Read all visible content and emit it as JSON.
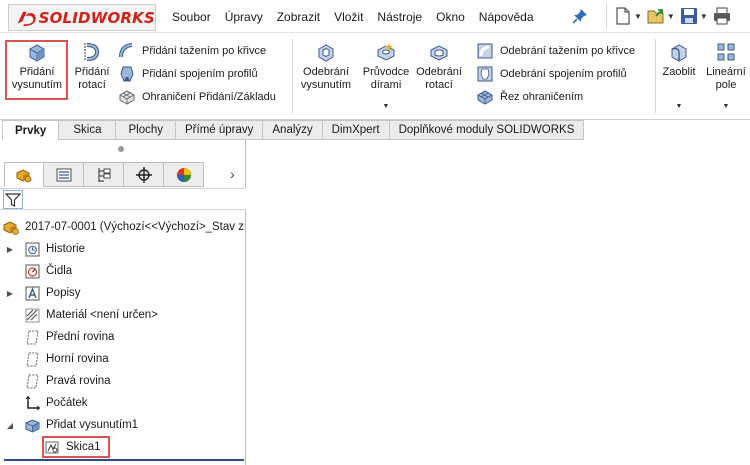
{
  "app": {
    "logo_text": "SOLIDWORKS",
    "brand_color": "#d0221b"
  },
  "menu": {
    "items": [
      "Soubor",
      "Úpravy",
      "Zobrazit",
      "Vložit",
      "Nástroje",
      "Okno",
      "Nápověda"
    ]
  },
  "quick_access": {
    "icons": [
      "new-document-icon",
      "open-file-icon",
      "save-icon",
      "print-icon"
    ]
  },
  "command_manager": {
    "extruded_boss": "Přidání\nvysunutím",
    "revolved_boss": "Přidání\nrotací",
    "swept_boss": "Přidání tažením po křivce",
    "lofted_boss": "Přidání spojením profilů",
    "boundary_boss": "Ohraničení Přidání/Základu",
    "extruded_cut": "Odebrání\nvysunutím",
    "hole_wizard": "Průvodce\ndírami",
    "revolved_cut": "Odebrání\nrotací",
    "swept_cut": "Odebrání tažením po křivce",
    "lofted_cut": "Odebrání spojením profilů",
    "boundary_cut": "Řez ohraničením",
    "fillet": "Zaoblit",
    "linear_pattern": "Lineární\npole"
  },
  "tabs": [
    {
      "label": "Prvky",
      "active": true
    },
    {
      "label": "Skica",
      "active": false
    },
    {
      "label": "Plochy",
      "active": false
    },
    {
      "label": "Přímé úpravy",
      "active": false
    },
    {
      "label": "Analýzy",
      "active": false
    },
    {
      "label": "DimXpert",
      "active": false
    },
    {
      "label": "Doplňkové moduly SOLIDWORKS",
      "active": false
    }
  ],
  "feature_tree": {
    "root": "2017-07-0001  (Výchozí<<Výchozí>_Stav z",
    "history": "Historie",
    "sensors": "Čidla",
    "annotations": "Popisy",
    "material": "Materiál <není určen>",
    "front_plane": "Přední rovina",
    "top_plane": "Horní rovina",
    "right_plane": "Pravá rovina",
    "origin": "Počátek",
    "extrude": "Přidat vysunutím1",
    "sketch": "Skica1"
  },
  "highlight_color": "#d9534f"
}
